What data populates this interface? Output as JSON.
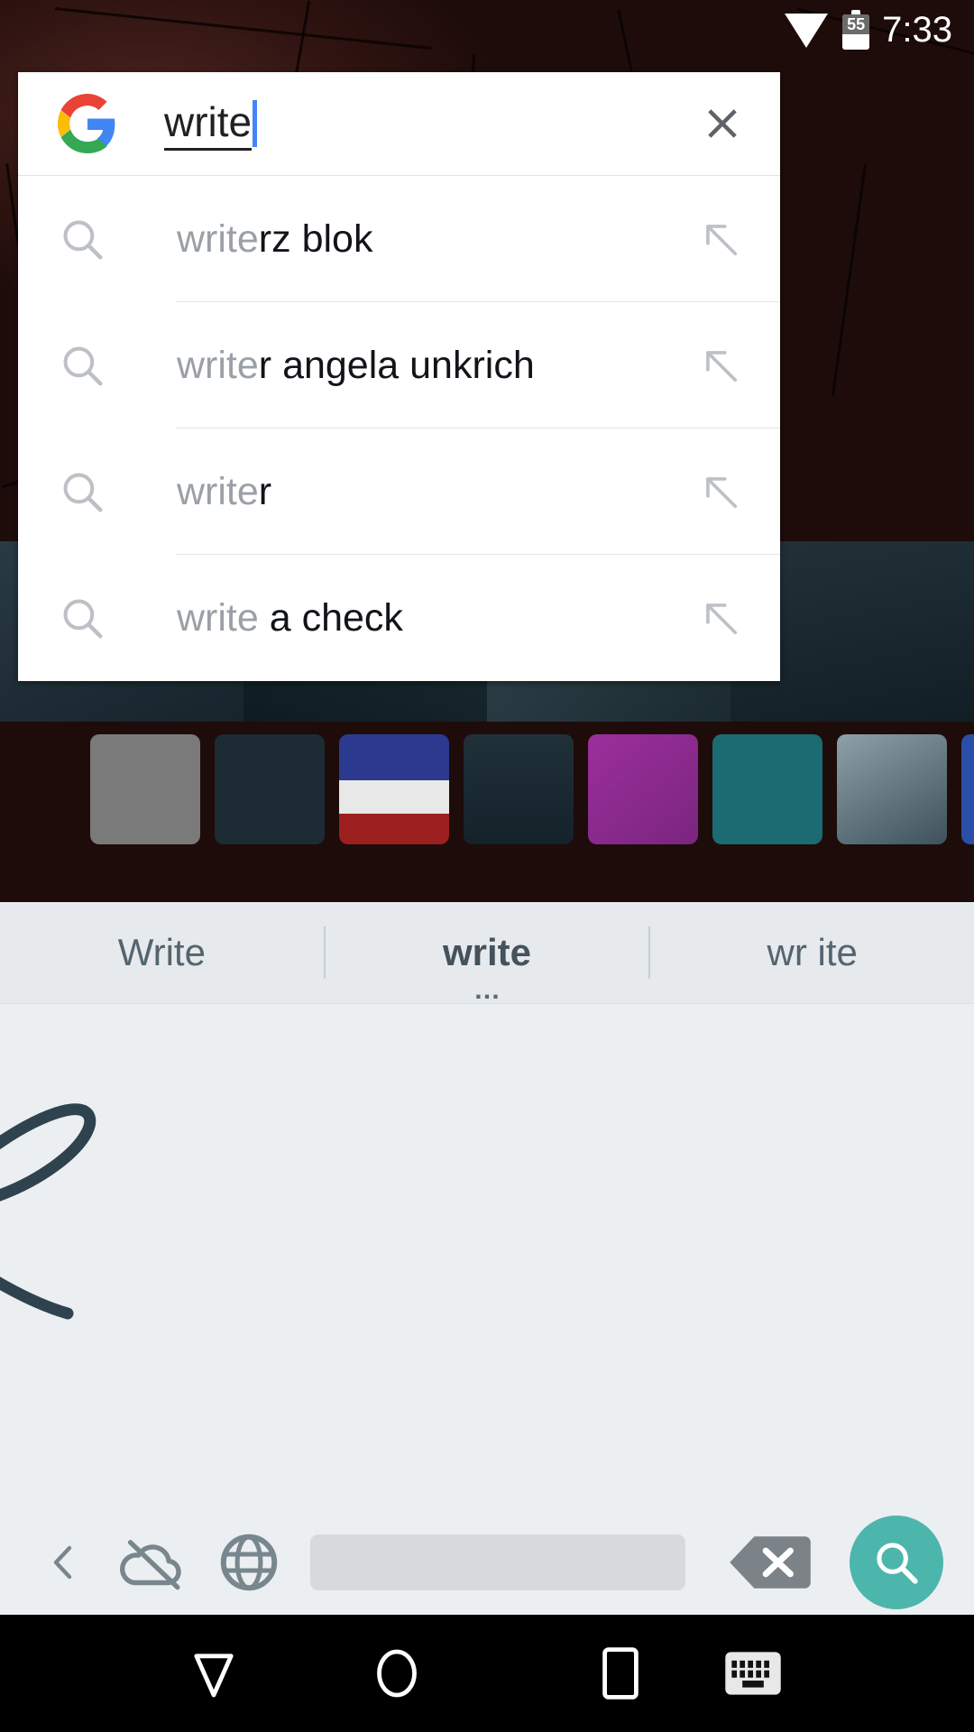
{
  "status_bar": {
    "wifi_icon": "wifi-icon",
    "battery_icon": "battery-icon",
    "battery_level": "55",
    "time": "7:33"
  },
  "search_dialog": {
    "google_logo_icon": "google-g-logo",
    "query": "write",
    "close_icon": "close-icon",
    "suggestions": [
      {
        "search_icon": "search-icon",
        "matched_prefix": "write",
        "completion": "rz blok",
        "fill_icon": "arrow-up-left-icon"
      },
      {
        "search_icon": "search-icon",
        "matched_prefix": "write",
        "completion": "r angela unkrich",
        "fill_icon": "arrow-up-left-icon"
      },
      {
        "search_icon": "search-icon",
        "matched_prefix": "write",
        "completion": "r",
        "fill_icon": "arrow-up-left-icon"
      },
      {
        "search_icon": "search-icon",
        "matched_prefix": "write ",
        "completion": "a check",
        "fill_icon": "arrow-up-left-icon"
      }
    ]
  },
  "keyboard": {
    "candidates": [
      {
        "label": "Write",
        "selected": false,
        "more_dots": ""
      },
      {
        "label": "write",
        "selected": true,
        "more_dots": "…"
      },
      {
        "label": "wr ite",
        "selected": false,
        "more_dots": ""
      }
    ],
    "handwriting_area_name": "handwriting-canvas",
    "bottom_row": {
      "back_icon": "chevron-left-icon",
      "cloud_off_icon": "cloud-off-icon",
      "language_icon": "globe-icon",
      "space_key": "space-bar",
      "delete_icon": "backspace-icon",
      "search_icon": "search-icon",
      "search_button_color": "#4DB6AC"
    }
  },
  "nav_bar": {
    "back_icon": "keyboard-down-icon",
    "home_icon": "home-circle-icon",
    "recents_icon": "recents-square-icon",
    "keyboard_switch_icon": "keyboard-switch-icon"
  },
  "colors": {
    "accent_blue": "#4285f4",
    "keyboard_bg": "#eceff1",
    "ink": "#2F434F",
    "suggestion_matched": "#9aa0a6"
  }
}
